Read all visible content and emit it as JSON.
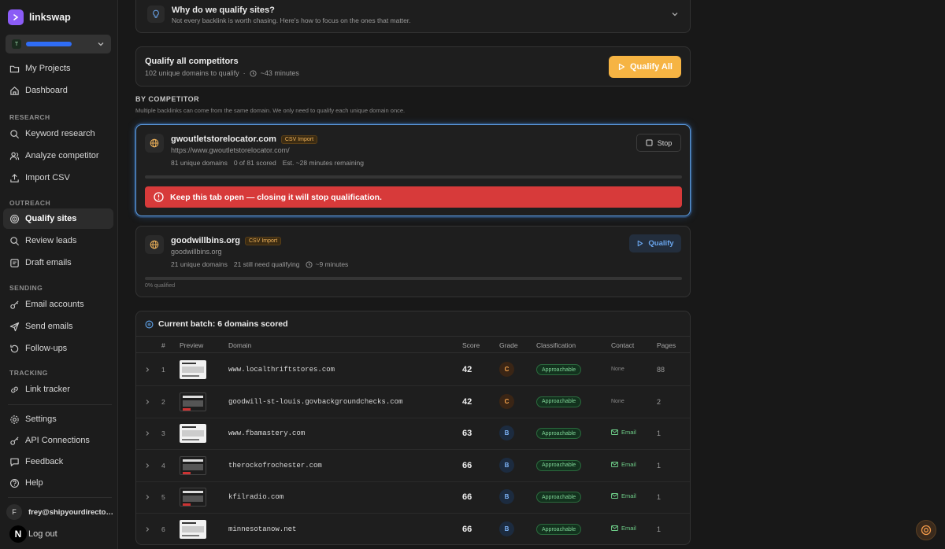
{
  "app": {
    "name": "linkswap"
  },
  "sidebar": {
    "team_initial": "T",
    "top_items": [
      {
        "label": "My Projects",
        "icon": "folder-icon"
      },
      {
        "label": "Dashboard",
        "icon": "home-icon"
      }
    ],
    "sections": [
      {
        "title": "RESEARCH",
        "items": [
          {
            "label": "Keyword research",
            "icon": "search-icon"
          },
          {
            "label": "Analyze competitor",
            "icon": "users-icon"
          },
          {
            "label": "Import CSV",
            "icon": "upload-icon"
          }
        ]
      },
      {
        "title": "OUTREACH",
        "items": [
          {
            "label": "Qualify sites",
            "icon": "target-icon",
            "active": true
          },
          {
            "label": "Review leads",
            "icon": "search-icon"
          },
          {
            "label": "Draft emails",
            "icon": "document-icon"
          }
        ]
      },
      {
        "title": "SENDING",
        "items": [
          {
            "label": "Email accounts",
            "icon": "key-icon"
          },
          {
            "label": "Send emails",
            "icon": "send-icon"
          },
          {
            "label": "Follow-ups",
            "icon": "refresh-icon"
          }
        ]
      },
      {
        "title": "TRACKING",
        "items": [
          {
            "label": "Link tracker",
            "icon": "link-icon"
          }
        ]
      }
    ],
    "bottom_items": [
      {
        "label": "Settings",
        "icon": "gear-icon"
      },
      {
        "label": "API Connections",
        "icon": "key-icon"
      },
      {
        "label": "Feedback",
        "icon": "message-icon"
      },
      {
        "label": "Help",
        "icon": "help-icon"
      }
    ],
    "user": {
      "initial": "F",
      "email": "frey@shipyourdirectory.com"
    },
    "logout_label": "Log out",
    "badge_letter": "N"
  },
  "why": {
    "title": "Why do we qualify sites?",
    "subtitle": "Not every backlink is worth chasing. Here's how to focus on the ones that matter."
  },
  "qualify_all": {
    "title": "Qualify all competitors",
    "domains_text": "102 unique domains to qualify",
    "time_text": "~43 minutes",
    "button_label": "Qualify All"
  },
  "by_competitor": {
    "title": "BY COMPETITOR",
    "subtitle": "Multiple backlinks can come from the same domain. We only need to qualify each unique domain once."
  },
  "competitors": [
    {
      "name": "gwoutletstorelocator.com",
      "badge": "CSV Import",
      "url": "https://www.gwoutletstorelocator.com/",
      "stat1": "81 unique domains",
      "stat2": "0 of 81 scored",
      "stat3": "Est. ~28 minutes remaining",
      "button_label": "Stop",
      "warning": "Keep this tab open — closing it will stop qualification.",
      "progress": 0.0
    },
    {
      "name": "goodwillbins.org",
      "badge": "CSV Import",
      "url": "goodwillbins.org",
      "stat1": "21 unique domains",
      "stat2": "21 still need qualifying",
      "stat3": "~9 minutes",
      "button_label": "Qualify",
      "progress_label": "0% qualified",
      "progress": 0.0
    }
  ],
  "batch": {
    "title": "Current batch: 6 domains scored",
    "columns": [
      "#",
      "Preview",
      "Domain",
      "Score",
      "Grade",
      "Classification",
      "Contact",
      "Pages"
    ],
    "rows": [
      {
        "num": "1",
        "domain": "www.localthriftstores.com",
        "score": "42",
        "grade": "C",
        "classification": "Approachable",
        "contact": "None",
        "pages": "88",
        "thumb": "light"
      },
      {
        "num": "2",
        "domain": "goodwill-st-louis.govbackgroundchecks.com",
        "score": "42",
        "grade": "C",
        "classification": "Approachable",
        "contact": "None",
        "pages": "2",
        "thumb": "dark"
      },
      {
        "num": "3",
        "domain": "www.fbamastery.com",
        "score": "63",
        "grade": "B",
        "classification": "Approachable",
        "contact": "Email",
        "pages": "1",
        "thumb": "light"
      },
      {
        "num": "4",
        "domain": "therockofrochester.com",
        "score": "66",
        "grade": "B",
        "classification": "Approachable",
        "contact": "Email",
        "pages": "1",
        "thumb": "dark"
      },
      {
        "num": "5",
        "domain": "kfilradio.com",
        "score": "66",
        "grade": "B",
        "classification": "Approachable",
        "contact": "Email",
        "pages": "1",
        "thumb": "dark"
      },
      {
        "num": "6",
        "domain": "minnesotanow.net",
        "score": "66",
        "grade": "B",
        "classification": "Approachable",
        "contact": "Email",
        "pages": "1",
        "thumb": "light"
      }
    ]
  },
  "colors": {
    "accent": "#f6b443",
    "brand": "#8b5cf6",
    "danger": "#d73a3a",
    "active_outline": "#5ea0e6"
  }
}
